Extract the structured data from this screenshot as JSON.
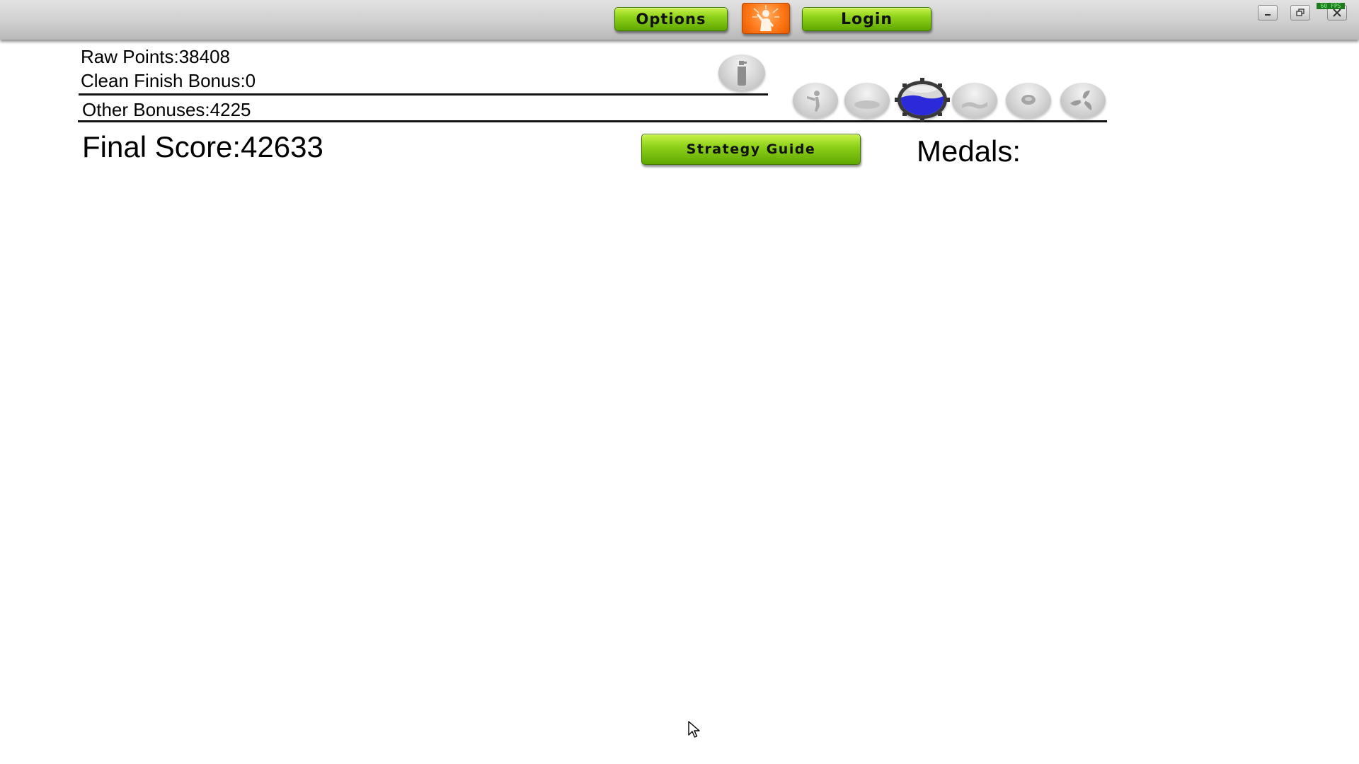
{
  "toolbar": {
    "options_label": "Options",
    "login_label": "Login",
    "avatar_icon": "character-avatar-icon",
    "fps_text": "60 FPS",
    "window_controls": {
      "minimize_icon": "minimize-icon",
      "restore_icon": "restore-icon",
      "close_icon": "close-icon"
    },
    "accent_green": "#8fd21a",
    "avatar_orange": "#ff7a1a"
  },
  "score": {
    "raw_points": "Raw Points:38408",
    "clean_finish_bonus": "Clean Finish Bonus:0",
    "other_bonuses": "Other Bonuses:4225",
    "final_score": "Final Score:42633",
    "medals_label": "Medals:"
  },
  "strategy_guide_label": "Strategy Guide",
  "level_icons": [
    {
      "name": "bottle-icon",
      "selected": false
    },
    {
      "name": "figure-icon",
      "selected": false
    },
    {
      "name": "blank-orb-icon",
      "selected": false
    },
    {
      "name": "water-tank-icon",
      "selected": true,
      "color": "#2a2adb"
    },
    {
      "name": "wave-icon",
      "selected": false
    },
    {
      "name": "disc-icon",
      "selected": false
    },
    {
      "name": "fan-icon",
      "selected": false
    }
  ]
}
